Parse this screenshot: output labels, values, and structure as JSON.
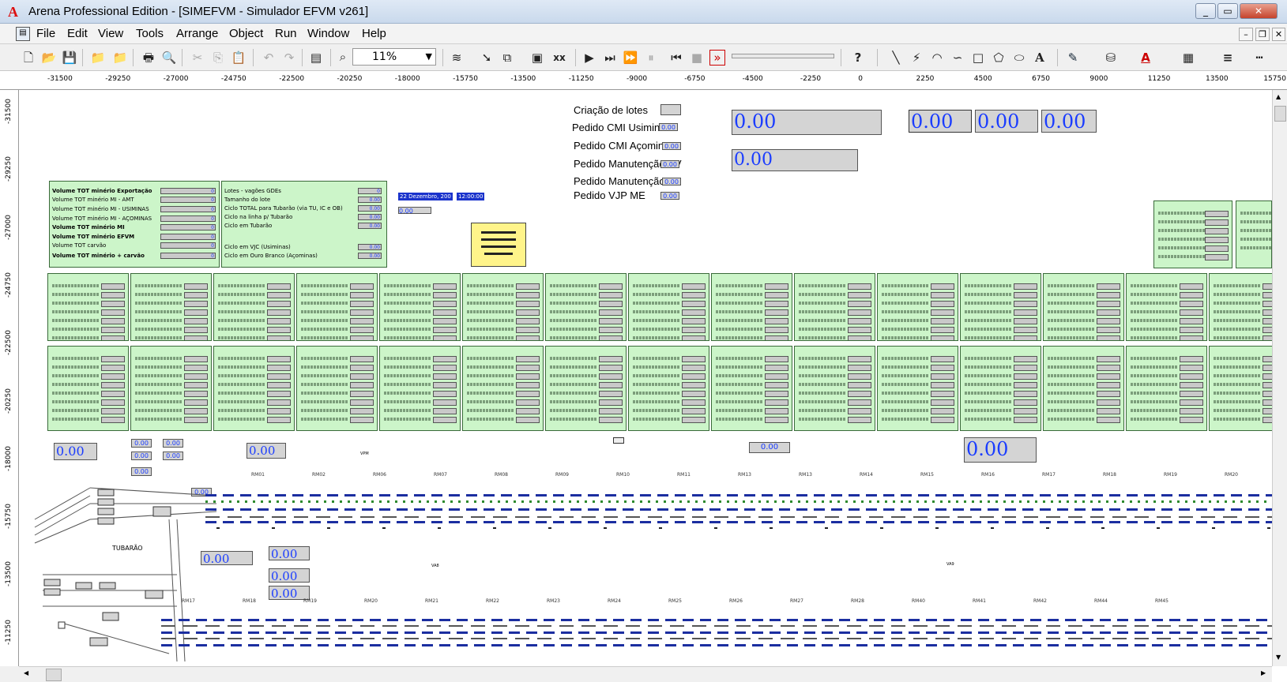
{
  "window": {
    "title": "Arena Professional Edition - [SIMEFVM - Simulador EFVM v261]",
    "app_icon": "arena-logo-icon",
    "controls": [
      "_",
      "▭",
      "✕"
    ]
  },
  "menu": [
    "File",
    "Edit",
    "View",
    "Tools",
    "Arrange",
    "Object",
    "Run",
    "Window",
    "Help"
  ],
  "toolbar": {
    "zoom_value": "11%",
    "icons": [
      "new-icon",
      "open-icon",
      "save-icon",
      "template-attach-icon",
      "template-detach-icon",
      "print-icon",
      "print-preview-icon",
      "cut-icon",
      "copy-icon",
      "paste-icon",
      "undo-icon",
      "redo-icon",
      "layers-icon",
      "zoom-icon",
      "connect-icon",
      "submodel-icon",
      "animate-icon",
      "variable-icon",
      "run-icon",
      "step-icon",
      "fast-forward-icon",
      "pause-icon",
      "start-over-icon",
      "end-icon",
      "batch-run-icon",
      "help-icon",
      "line-icon",
      "polyline-icon",
      "arc-icon",
      "bezier-icon",
      "box-icon",
      "polygon-icon",
      "ellipse-icon",
      "text-icon",
      "line-color-icon",
      "fill-color-icon",
      "text-color-icon",
      "window-background-icon",
      "line-width-icon",
      "line-style-icon"
    ]
  },
  "ruler": {
    "h_ticks": [
      "-31500",
      "-29250",
      "-27000",
      "-24750",
      "-22500",
      "-20250",
      "-18000",
      "-15750",
      "-13500",
      "-11250",
      "-9000",
      "-6750",
      "-4500",
      "-2250",
      "0",
      "2250",
      "4500",
      "6750",
      "9000",
      "11250",
      "13500",
      "15750"
    ],
    "v_ticks": [
      "-31500",
      "-29250",
      "-27000",
      "-24750",
      "-22500",
      "-20250",
      "-18000",
      "-15750",
      "-13500",
      "-11250"
    ]
  },
  "top_labels": {
    "criacao": "Criação de lotes",
    "cmi_usiminas": "Pedido CMI Usiminas",
    "cmi_acominas": "Pedido CMI Açominas",
    "manut_vv": "Pedido Manutenção VV",
    "manut_vp": "Pedido Manutenção VP",
    "vjp_me": "Pedido VJP ME",
    "small_val": "0.00"
  },
  "big_values": [
    "0.00",
    "0.00",
    "0.00",
    "0.00",
    "0.00"
  ],
  "summary": {
    "left_labels": [
      "Volume TOT minério Exportação",
      "Volume TOT minério MI - AMT",
      "Volume TOT minério MI - USIMINAS",
      "Volume TOT minério MI - AÇOMINAS",
      "Volume TOT minério MI",
      "Volume TOT minério EFVM",
      "Volume TOT carvão",
      "Volume TOT minério + carvão"
    ],
    "left_values": [
      "0",
      "0",
      "0",
      "0",
      "0",
      "0",
      "0",
      "0"
    ],
    "mid_labels": [
      "Lotes - vagões GDEs",
      "Tamanho do lote",
      "Ciclo TOTAL para Tubarão (via TU, IC e OB)",
      "Ciclo na linha p/ Tubarão",
      "Ciclo em Tubarão",
      "Ciclo em VJC (Usiminas)",
      "Ciclo em Ouro Branco (Açominas)"
    ],
    "mid_values": [
      "0",
      "0.00",
      "0.00",
      "0.00",
      "0.00",
      "0.00",
      "0.00"
    ],
    "date": "22 Dezembro, 200",
    "time": "12:00:00",
    "extra_val": "0.00"
  },
  "lower_values": [
    "0.00",
    "0.00",
    "0.00",
    "0.00",
    "0.00",
    "0.00",
    "0.00",
    "0.00",
    "0.00",
    "0.00",
    "0.00",
    "0.00"
  ],
  "places": {
    "tubarao": "TUBARÃO",
    "vpm": "VPM",
    "va8": "VA8",
    "va9": "VA9"
  },
  "rm_top": [
    "RM01",
    "RM02",
    "RM06",
    "RM07",
    "RM08",
    "RM09",
    "RM10",
    "RM11",
    "RM13",
    "RM13",
    "RM14",
    "RM15",
    "RM16",
    "RM17",
    "RM18",
    "RM19",
    "RM20"
  ],
  "rm_bottom": [
    "RM17",
    "RM18",
    "RM19",
    "RM20",
    "RM21",
    "RM22",
    "RM23",
    "RM24",
    "RM25",
    "RM26",
    "RM27",
    "RM28",
    "RM40",
    "RM41",
    "RM42",
    "RM44",
    "RM45"
  ]
}
